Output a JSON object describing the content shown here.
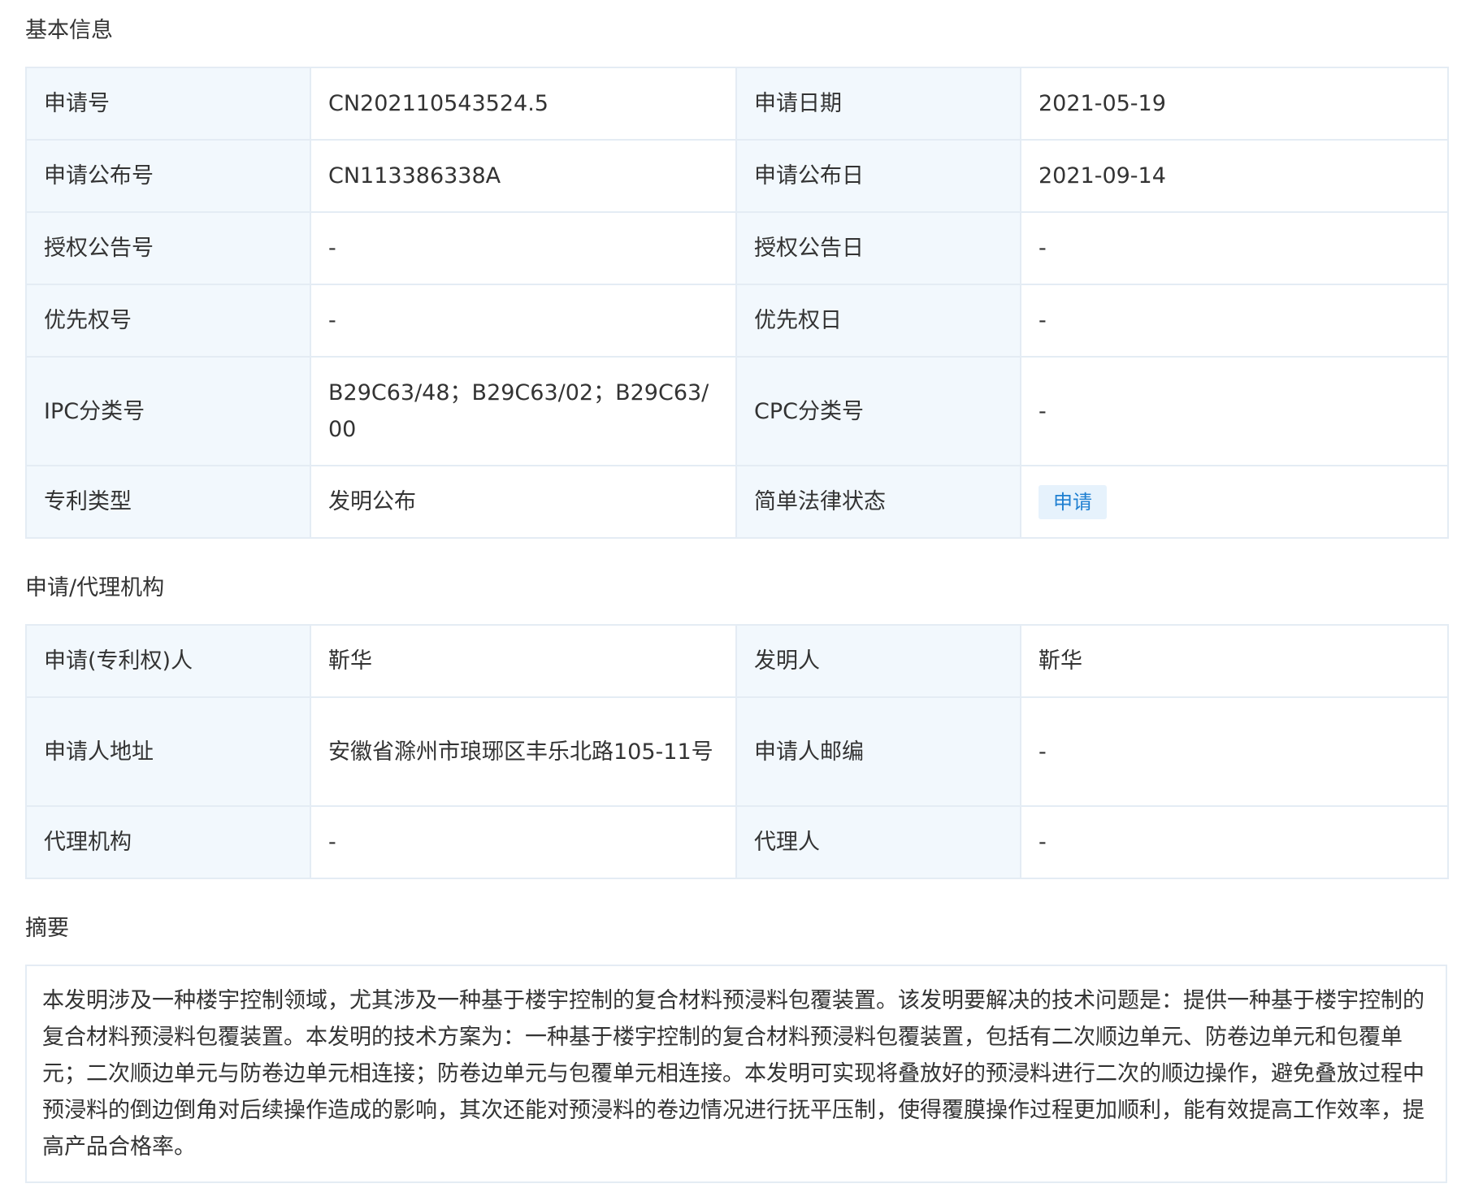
{
  "basic": {
    "title": "基本信息",
    "rows": [
      {
        "l1": "申请号",
        "v1": "CN202110543524.5",
        "l2": "申请日期",
        "v2": "2021-05-19"
      },
      {
        "l1": "申请公布号",
        "v1": "CN113386338A",
        "l2": "申请公布日",
        "v2": "2021-09-14"
      },
      {
        "l1": "授权公告号",
        "v1": "-",
        "l2": "授权公告日",
        "v2": "-"
      },
      {
        "l1": "优先权号",
        "v1": "-",
        "l2": "优先权日",
        "v2": "-"
      },
      {
        "l1": "IPC分类号",
        "v1": "B29C63/48；B29C63/02；B29C63/00",
        "l2": "CPC分类号",
        "v2": "-"
      },
      {
        "l1": "专利类型",
        "v1": "发明公布",
        "l2": "简单法律状态",
        "v2": "申请"
      }
    ]
  },
  "agency": {
    "title": "申请/代理机构",
    "rows": [
      {
        "l1": "申请(专利权)人",
        "v1": "靳华",
        "l2": "发明人",
        "v2": "靳华"
      },
      {
        "l1": "申请人地址",
        "v1": "安徽省滁州市琅琊区丰乐北路105-11号",
        "l2": "申请人邮编",
        "v2": "-"
      },
      {
        "l1": "代理机构",
        "v1": "-",
        "l2": "代理人",
        "v2": "-"
      }
    ]
  },
  "abstract": {
    "title": "摘要",
    "text": "本发明涉及一种楼宇控制领域，尤其涉及一种基于楼宇控制的复合材料预浸料包覆装置。该发明要解决的技术问题是：提供一种基于楼宇控制的复合材料预浸料包覆装置。本发明的技术方案为：一种基于楼宇控制的复合材料预浸料包覆装置，包括有二次顺边单元、防卷边单元和包覆单元；二次顺边单元与防卷边单元相连接；防卷边单元与包覆单元相连接。本发明可实现将叠放好的预浸料进行二次的顺边操作，避免叠放过程中预浸料的倒边倒角对后续操作造成的影响，其次还能对预浸料的卷边情况进行抚平压制，使得覆膜操作过程更加顺利，能有效提高工作效率，提高产品合格率。"
  }
}
